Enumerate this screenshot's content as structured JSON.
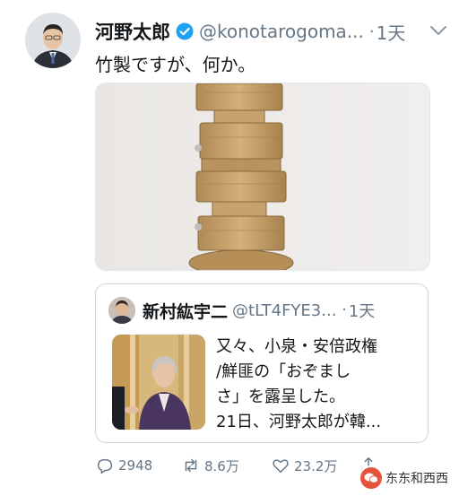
{
  "tweet": {
    "author_name": "河野太郎",
    "handle": "@konotarogoma...",
    "separator": "·",
    "time": "1天",
    "text": "竹製ですが、何か。"
  },
  "quoted": {
    "author_name": "新村紘宇二",
    "handle": "@tLT4FYE3...",
    "separator": "·",
    "time": "1天",
    "lines": [
      "又々、小泉・安倍政権",
      "/鮮匪の「おぞまし",
      "さ」を露呈した。",
      "21日、河野太郎が韓..."
    ]
  },
  "actions": {
    "reply_count": "2948",
    "retweet_count": "8.6万",
    "like_count": "23.2万"
  },
  "watermark": {
    "text": "东东和西西",
    "icon": "wechat-icon"
  },
  "colors": {
    "verified": "#1da1f2",
    "muted": "#657786",
    "border": "#e1e8ed"
  }
}
